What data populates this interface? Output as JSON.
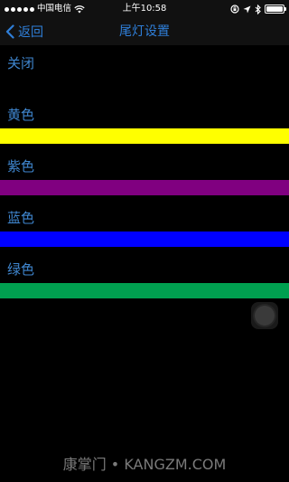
{
  "status_bar": {
    "carrier": "中国电信",
    "time": "上午10:58",
    "signal_icon": "signal-dots-icon",
    "wifi_icon": "wifi-icon",
    "right_icons": [
      "rotation-lock-icon",
      "location-icon",
      "bluetooth-icon",
      "battery-icon"
    ]
  },
  "nav": {
    "back_label": "返回",
    "title": "尾灯设置",
    "accent": "#2f7fd9"
  },
  "options": [
    {
      "label": "关闭",
      "bar_color": null
    },
    {
      "label": "黄色",
      "bar_color": "#ffff00"
    },
    {
      "label": "紫色",
      "bar_color": "#800080"
    },
    {
      "label": "蓝色",
      "bar_color": "#0000ff"
    },
    {
      "label": "绿色",
      "bar_color": "#00a050"
    }
  ],
  "colors": {
    "background": "#000000",
    "option_text": "#3f86cf"
  },
  "watermark": "康掌门 • KANGZM.COM"
}
